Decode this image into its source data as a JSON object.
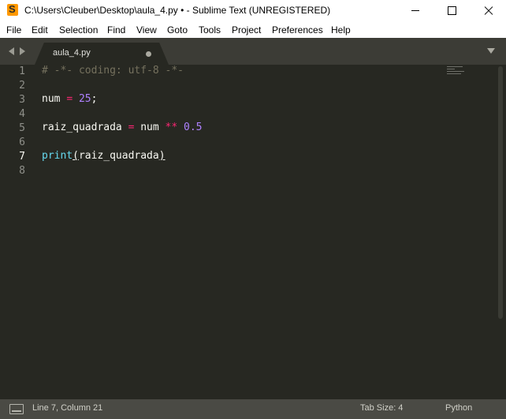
{
  "window": {
    "title": "C:\\Users\\Cleuber\\Desktop\\aula_4.py • - Sublime Text (UNREGISTERED)",
    "app_icon": "sublime-text-icon"
  },
  "menu": [
    "File",
    "Edit",
    "Selection",
    "Find",
    "View",
    "Goto",
    "Tools",
    "Project",
    "Preferences",
    "Help"
  ],
  "tabs": [
    {
      "label": "aula_4.py",
      "modified": true
    }
  ],
  "editor": {
    "line_numbers": [
      "1",
      "2",
      "3",
      "4",
      "5",
      "6",
      "7",
      "8"
    ],
    "current_line": 7,
    "code": {
      "line1": "# -*- coding: utf-8 -*-",
      "line3_var": "num",
      "line3_op": "=",
      "line3_num": "25",
      "line3_end": ";",
      "line5_var": "raiz_quadrada",
      "line5_op1": "=",
      "line5_var2": "num",
      "line5_op2": "**",
      "line5_num": "0.5",
      "line7_fn": "print",
      "line7_open": "(",
      "line7_arg": "raiz_quadrada",
      "line7_close": ")"
    },
    "theme_colors": {
      "background": "#272822",
      "comment": "#75715e",
      "operator": "#f92672",
      "number": "#ae81ff",
      "builtin": "#66d9ef"
    }
  },
  "status": {
    "position": "Line 7, Column 21",
    "tab_size": "Tab Size: 4",
    "syntax": "Python"
  }
}
